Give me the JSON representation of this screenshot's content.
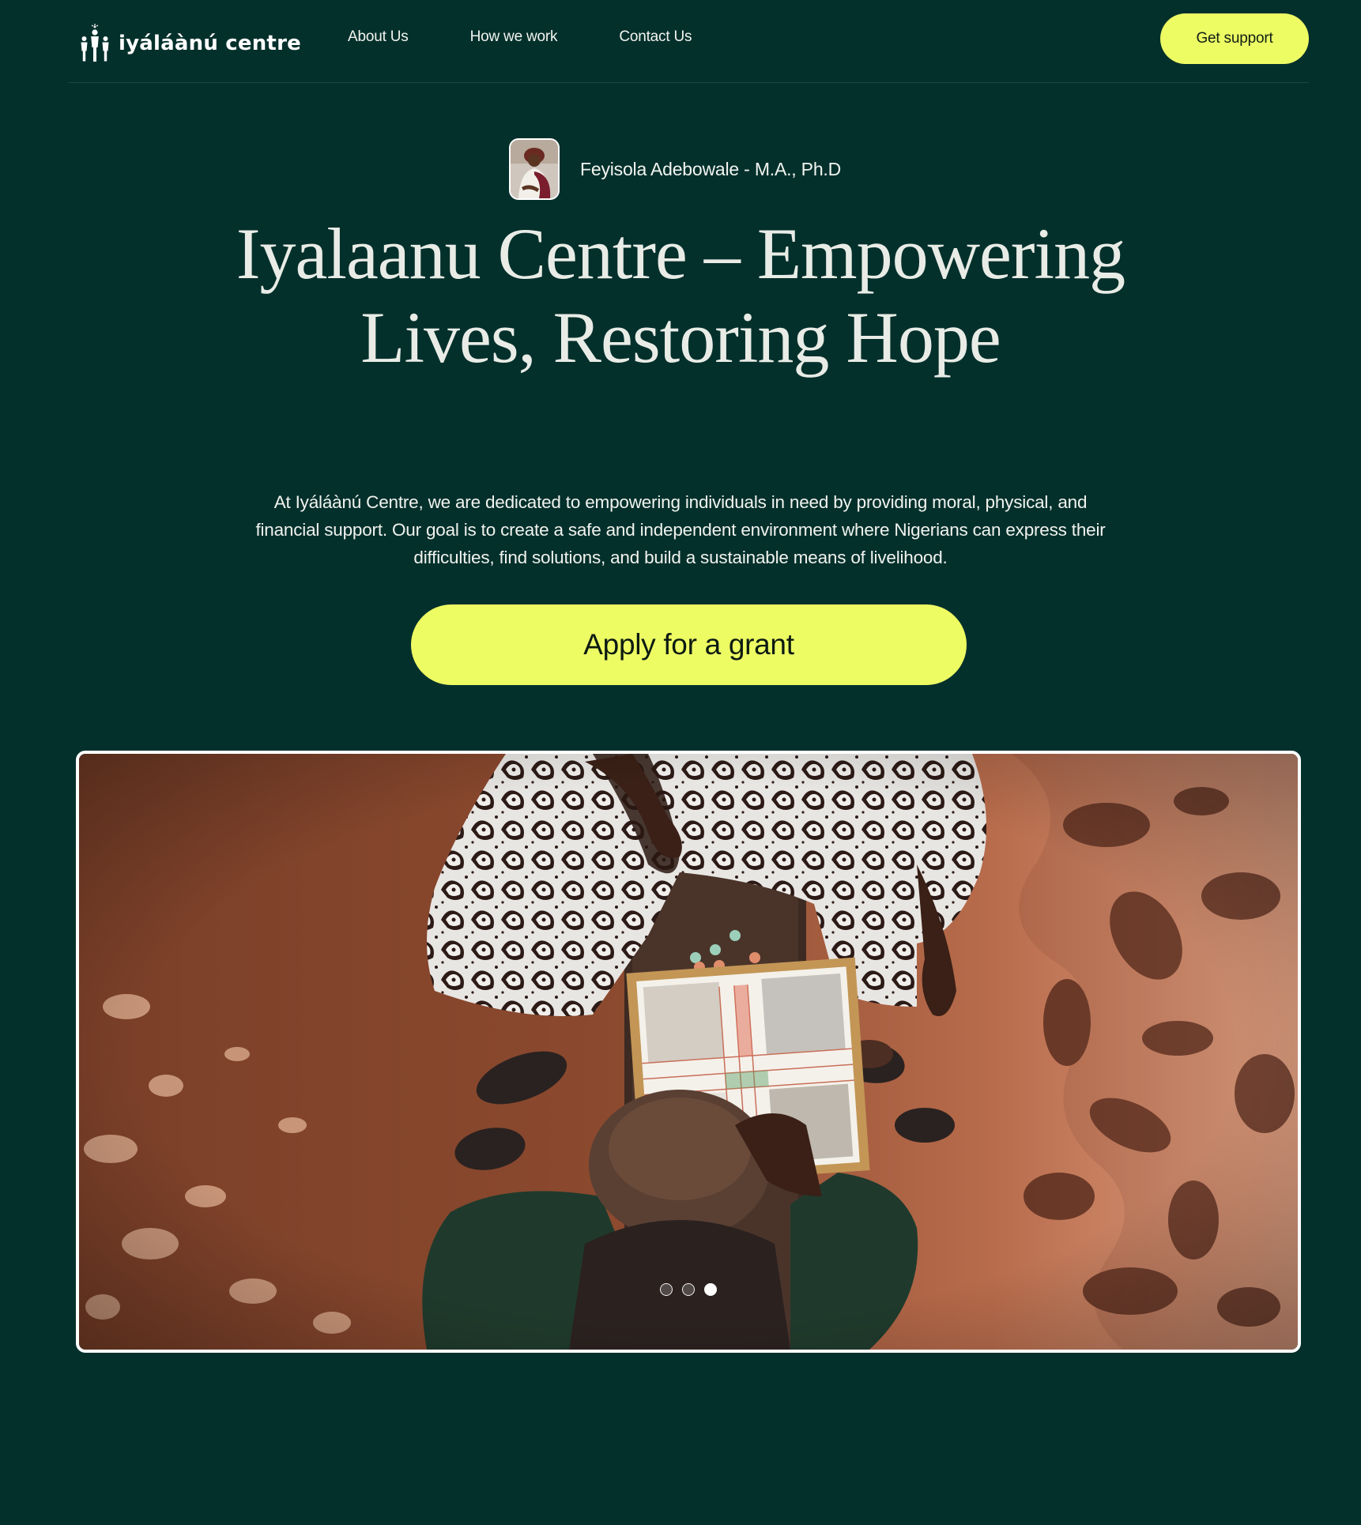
{
  "header": {
    "brand": "iyáláànú centre",
    "nav": [
      {
        "label": "About Us"
      },
      {
        "label": "How we work"
      },
      {
        "label": "Contact Us"
      }
    ],
    "cta_label": "Get support"
  },
  "hero": {
    "author_name": "Feyisola Adebowale - M.A., Ph.D",
    "title": "Iyalaanu Centre – Empowering Lives, Restoring Hope",
    "description": "At Iyáláànú Centre, we are dedicated to empowering individuals in need by providing moral, physical, and financial support. Our goal is to create a safe and independent environment where Nigerians can express their difficulties, find solutions, and build a sustainable means of livelihood.",
    "cta_label": "Apply for a grant"
  },
  "carousel": {
    "slide_count": 3,
    "active_index": 2
  },
  "colors": {
    "background": "#04302c",
    "accent": "#eefc64",
    "text": "#eef0e8"
  }
}
